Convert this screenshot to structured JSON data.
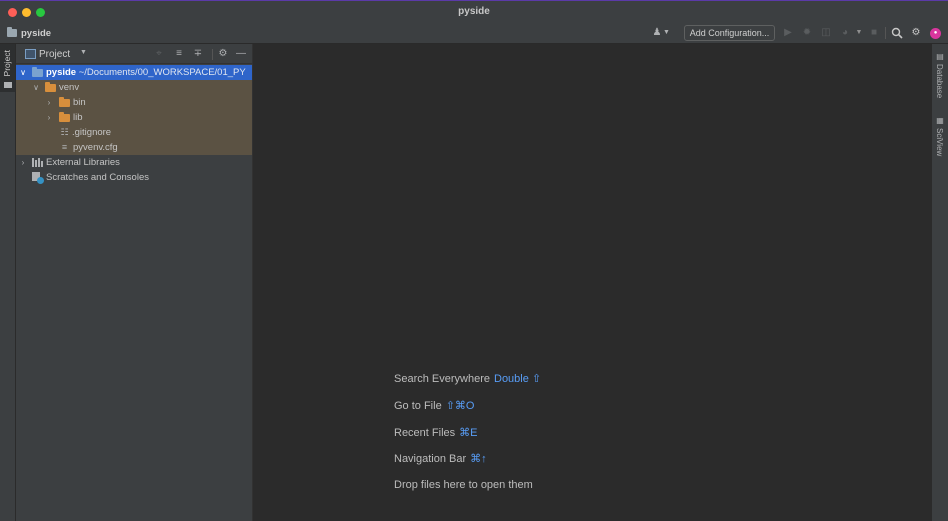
{
  "window": {
    "title": "pyside"
  },
  "navbar": {
    "project_name": "pyside",
    "add_configuration_label": "Add Configuration...",
    "icons": [
      "user-icon",
      "run-icon",
      "debug-icon",
      "coverage-icon",
      "profile-icon",
      "stop-icon",
      "search-icon",
      "settings-icon",
      "avatar"
    ]
  },
  "left_stripe": {
    "project_tab_label": "Project"
  },
  "project_panel": {
    "view_label": "Project",
    "tree": {
      "root_name": "pyside",
      "root_path": "~/Documents/00_WORKSPACE/01_PY",
      "venv": "venv",
      "bin": "bin",
      "lib": "lib",
      "gitignore": ".gitignore",
      "pyvenv_cfg": "pyvenv.cfg",
      "external_libraries": "External Libraries",
      "scratches": "Scratches and Consoles"
    }
  },
  "editor": {
    "hints": [
      {
        "label": "Search Everywhere",
        "shortcut": "Double ⇧"
      },
      {
        "label": "Go to File",
        "shortcut": "⇧⌘O"
      },
      {
        "label": "Recent Files",
        "shortcut": "⌘E"
      },
      {
        "label": "Navigation Bar",
        "shortcut": "⌘↑"
      },
      {
        "label": "Drop files here to open them",
        "shortcut": ""
      }
    ]
  },
  "right_stripe": {
    "database_label": "Database",
    "sciview_label": "SciView"
  },
  "colors": {
    "selection": "#2f65ca",
    "venv_highlight": "#5b5243",
    "shortcut_blue": "#589df6",
    "avatar": "#d9369e"
  }
}
